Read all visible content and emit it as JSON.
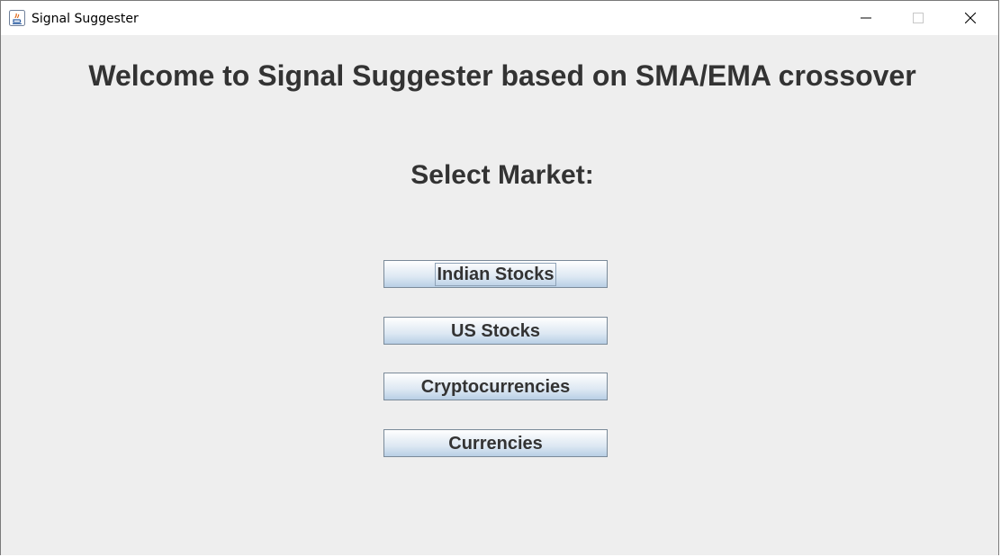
{
  "window": {
    "title": "Signal Suggester",
    "controls": {
      "minimize_icon": "minimize-icon",
      "maximize_icon": "maximize-icon",
      "close_icon": "close-icon"
    }
  },
  "main": {
    "welcome_text": "Welcome to Signal Suggester based on SMA/EMA crossover",
    "select_label": "Select Market:",
    "buttons": [
      {
        "label": "Indian Stocks",
        "focused": true
      },
      {
        "label": "US Stocks",
        "focused": false
      },
      {
        "label": "Cryptocurrencies",
        "focused": false
      },
      {
        "label": "Currencies",
        "focused": false
      }
    ]
  },
  "colors": {
    "background": "#eeeeee",
    "text": "#333333",
    "button_border": "#7a8a99"
  }
}
